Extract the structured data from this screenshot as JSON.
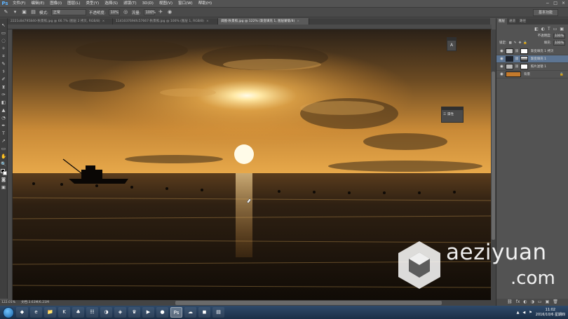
{
  "app": {
    "logo": "Ps"
  },
  "menu": [
    "文件(F)",
    "编辑(E)",
    "图像(I)",
    "图层(L)",
    "类型(Y)",
    "选择(S)",
    "滤镜(T)",
    "3D(D)",
    "视图(V)",
    "窗口(W)",
    "帮助(H)"
  ],
  "window_controls": [
    "−",
    "□",
    "×"
  ],
  "options": {
    "mode_label": "模式:",
    "mode_value": "正常",
    "opacity_label": "不透明度:",
    "opacity_value": "10%",
    "flow_label": "流量:",
    "flow_value": "100%",
    "workspace": "基本功能"
  },
  "tabs": [
    {
      "label": "2221c8d795840-秋景照.jpg @ 66.7% (图层 2 拷贝, RGB/8)",
      "active": false
    },
    {
      "label": "1141037694fc57667-秋景照.jpg @ 100% (图层 1, RGB/8)",
      "active": false
    },
    {
      "label": "调图-秋景照.jpg @ 122% (渐变填充 1, 图层蒙版/8)",
      "active": true
    }
  ],
  "tools": [
    "↖",
    "▭",
    "◌",
    "✧",
    "⌗",
    "✎",
    "⚕",
    "✐",
    "⧗",
    "✑",
    "◧",
    "▲",
    "◔",
    "✒",
    "T",
    "↗",
    "▭",
    "✋",
    "🔍"
  ],
  "status": {
    "zoom": "122.01%",
    "doc": "文档:3.63M/6.21M"
  },
  "floating": {
    "char_icon": "A",
    "prop_label": "属性"
  },
  "right_panel": {
    "tabs": [
      "图层",
      "通道",
      "路径"
    ],
    "opacity_label": "不透明度:",
    "opacity_value": "100%",
    "lock_label": "锁定:",
    "fill_label": "填充:",
    "fill_value": "100%",
    "layers": [
      {
        "name": "渐变填充 1 拷贝",
        "thumb": "#c9c9c9",
        "selected": false,
        "visible": true
      },
      {
        "name": "渐变填充 1",
        "thumb": "#1c2330",
        "selected": true,
        "visible": true
      },
      {
        "name": "照片滤镜 1",
        "thumb": "#b8b8b8",
        "selected": false,
        "visible": true
      },
      {
        "name": "背景",
        "thumb": "#c47a2c",
        "selected": false,
        "visible": true
      }
    ],
    "bottom_icons": [
      "⛓",
      "fx",
      "◐",
      "◑",
      "▭",
      "▣",
      "🗑"
    ]
  },
  "taskbar": {
    "apps": [
      "◆",
      "e",
      "📁",
      "K",
      "♣",
      "☷",
      "◑",
      "◈",
      "♛",
      "▶",
      "●",
      "Ps",
      "☁",
      "◼",
      "▤"
    ],
    "active_app": "Ps",
    "time": "11:02",
    "date": "2016/10/6 星期四"
  },
  "watermark": {
    "text": "aeziyuan",
    "domain": ".com"
  },
  "colors": {
    "accent": "#5d7593",
    "ps_blue": "#5fb4ff",
    "sky_top": "#2a2520",
    "sun": "#fff2c8",
    "sea": "#1a130b"
  }
}
